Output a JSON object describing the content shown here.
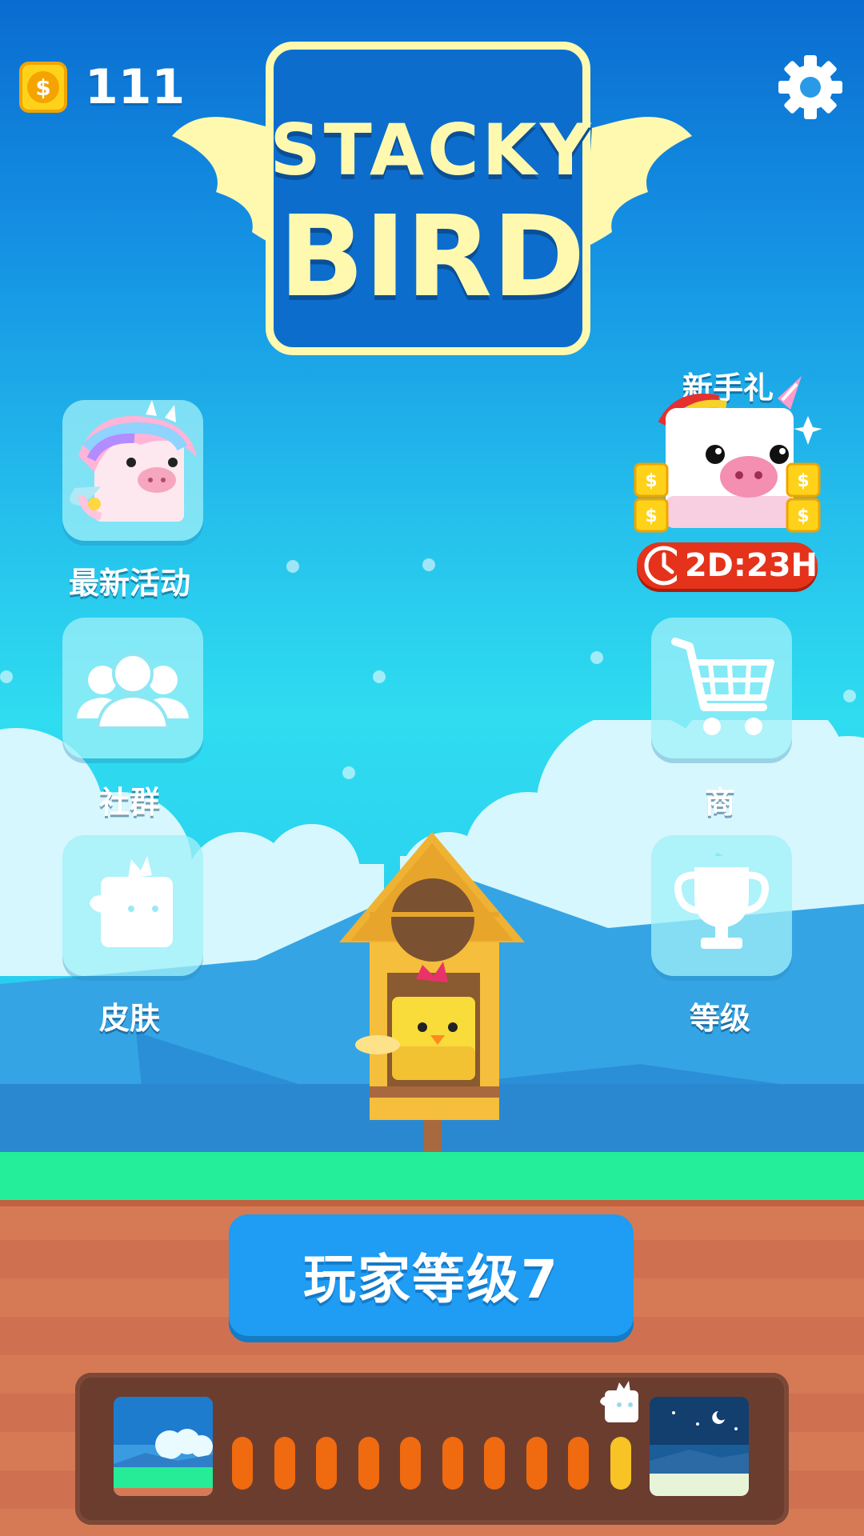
{
  "hud": {
    "coins": "111",
    "coin_icon": "dollar-coin-icon",
    "settings_icon": "gear-icon"
  },
  "logo": {
    "line1": "STACKY",
    "line2": "BIRD"
  },
  "menu": {
    "events_label": "最新活动",
    "community_label": "社群",
    "skins_label": "皮肤",
    "shop_label": "商",
    "rank_label": "等级",
    "newbie_gift_label": "新手礼",
    "gift_timer": "2D:23H"
  },
  "play": {
    "level_label": "玩家等级7"
  },
  "progress": {
    "total_pips": 10,
    "completed_pips": 9,
    "colors": {
      "done": "#f06a10",
      "current": "#f7c325"
    }
  },
  "colors": {
    "sky_top": "#0a6cd0",
    "sky_mid": "#2fdcf0",
    "grass": "#24ee9a",
    "dirt": "#d67a55",
    "button": "#1f9cf3",
    "logo_cream": "#fff9b0",
    "timer_red": "#e4321b"
  }
}
